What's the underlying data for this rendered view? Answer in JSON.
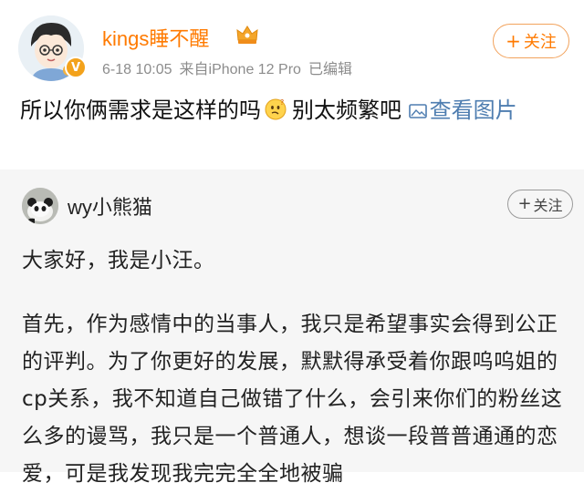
{
  "post": {
    "username": "kings睡不醒",
    "date": "6-18 10:05",
    "source": "来自iPhone 12 Pro",
    "edited": "已编辑",
    "follow_label": "关注",
    "text_before_emoji": "所以你俩需求是这样的吗",
    "text_after_emoji": "别太频繁吧",
    "view_image_link": "查看图片",
    "emoji": "thinking-emoji",
    "badge_icon": "crown-badge-icon",
    "username_color": "#ff7a00"
  },
  "repost": {
    "username": "wy小熊猫",
    "follow_label": "关注",
    "paragraph1": "大家好，我是小汪。",
    "paragraph2": "首先，作为感情中的当事人，我只是希望事实会得到公正的评判。为了你更好的发展，默默得承受着你跟呜呜姐的cp关系，我不知道自己做错了什么，会引来你们的粉丝这么多的谩骂，我只是一个普通人，想谈一段普普通通的恋爱，可是我发现我完完全全地被骗"
  }
}
